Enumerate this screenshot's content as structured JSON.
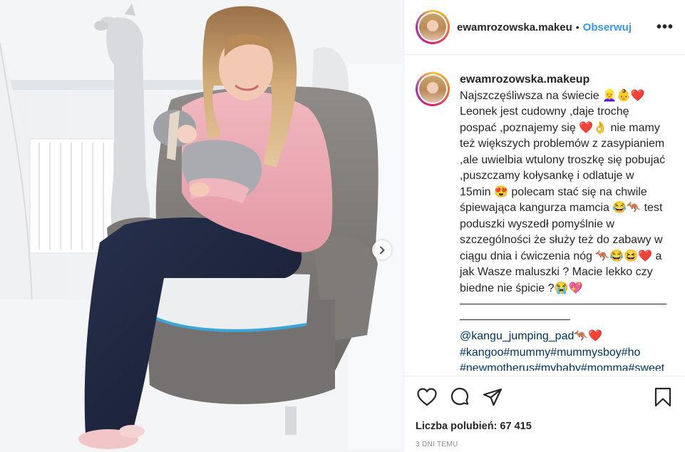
{
  "post": {
    "username": "ewamrozowska.makeup",
    "username_truncated": "ewamrozowska.makeu",
    "separator": "•",
    "follow_label": "Obserwuj",
    "more_label": "•••"
  },
  "caption": {
    "username": "ewamrozowska.makeup",
    "text": "Najszczęśliwsza na świecie 👱‍♀️👶❤️ Leonek jest cudowny ,daje trochę pospać ,poznajemy się ❤️👌 nie mamy też większych problemów z zasypianiem ,ale uwielbia wtulony troszkę się pobujać ,puszczamy kołysankę i odlatuje w 15min 😍 polecam stać się na chwile śpiewająca kangurza mamcia 😂🦘 test poduszki wyszedł pomyślnie w szczególności że służy też do zabawy w ciągu dnia i ćwiczenia nóg 🦘😂😆❤️ a jak Wasze maluszki ? Macie lekko czy biedne nie śpicie ?😭💖",
    "mention": "@kangu_jumping_pad🦘❤️",
    "hashtags": "#kangoo#mummy#mummysboy#ho",
    "hashtags_clipped": "#newmotherus#mybaby#momma#sweet"
  },
  "actions": {
    "like_icon": "heart-icon",
    "comment_icon": "comment-icon",
    "share_icon": "share-icon",
    "save_icon": "bookmark-icon"
  },
  "likes_text": "Liczba polubień: 67 415",
  "time_ago": "3 DNI TEMU",
  "photo": {
    "next_icon": "chevron-right-icon"
  }
}
